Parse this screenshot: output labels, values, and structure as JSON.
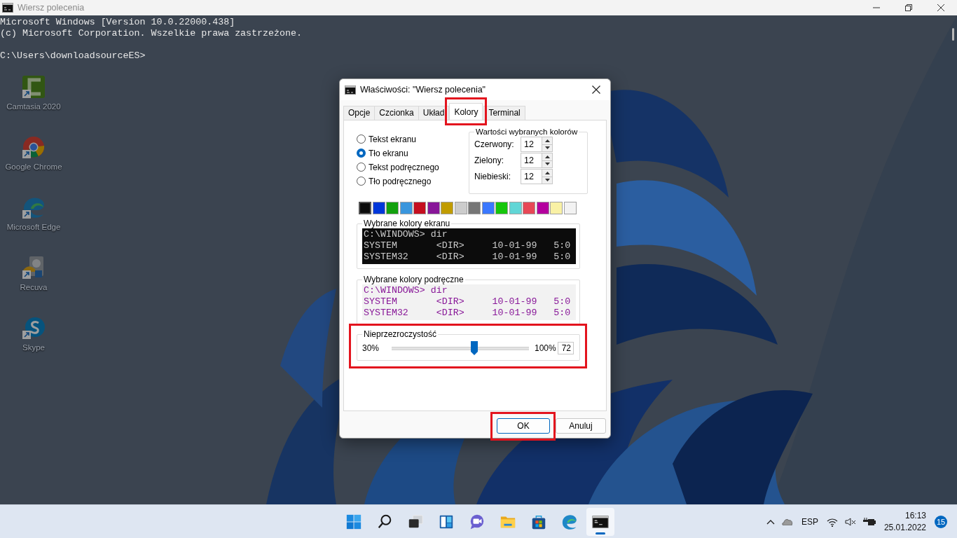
{
  "console": {
    "title": "Wiersz polecenia",
    "lines": [
      "Microsoft Windows [Version 10.0.22000.438]",
      "(c) Microsoft Corporation. Wszelkie prawa zastrzeżone."
    ],
    "prompt": "C:\\Users\\downloadsourceES>"
  },
  "desktop_icons": [
    {
      "kind": "camtasia",
      "label": "Camtasia 2020"
    },
    {
      "kind": "chrome",
      "label": "Google Chrome"
    },
    {
      "kind": "edge",
      "label": "Microsoft Edge"
    },
    {
      "kind": "recuva",
      "label": "Recuva"
    },
    {
      "kind": "skype",
      "label": "Skype"
    }
  ],
  "dialog": {
    "title": "Właściwości: \"Wiersz polecenia\"",
    "tabs": [
      {
        "label": "Opcje",
        "selected": false,
        "highlighted": false
      },
      {
        "label": "Czcionka",
        "selected": false,
        "highlighted": false
      },
      {
        "label": "Układ",
        "selected": false,
        "highlighted": false
      },
      {
        "label": "Kolory",
        "selected": true,
        "highlighted": true
      },
      {
        "label": "Terminal",
        "selected": false,
        "highlighted": false
      }
    ],
    "color_targets": [
      {
        "label": "Tekst ekranu",
        "selected": false
      },
      {
        "label": "Tło ekranu",
        "selected": true
      },
      {
        "label": "Tekst podręcznego",
        "selected": false
      },
      {
        "label": "Tło podręcznego",
        "selected": false
      }
    ],
    "color_values": {
      "title": "Wartości wybranych kolorów",
      "fields": [
        {
          "label": "Czerwony:",
          "value": "12"
        },
        {
          "label": "Zielony:",
          "value": "12"
        },
        {
          "label": "Niebieski:",
          "value": "12"
        }
      ]
    },
    "palette": [
      {
        "color": "#0c0c0c",
        "selected": true
      },
      {
        "color": "#0037da",
        "selected": false
      },
      {
        "color": "#13a10e",
        "selected": false
      },
      {
        "color": "#3a96dd",
        "selected": false
      },
      {
        "color": "#c50f1f",
        "selected": false
      },
      {
        "color": "#881798",
        "selected": false
      },
      {
        "color": "#c19c00",
        "selected": false
      },
      {
        "color": "#cccccc",
        "selected": false
      },
      {
        "color": "#767676",
        "selected": false
      },
      {
        "color": "#3b78ff",
        "selected": false
      },
      {
        "color": "#16c60c",
        "selected": false
      },
      {
        "color": "#61d6d6",
        "selected": false
      },
      {
        "color": "#e74856",
        "selected": false
      },
      {
        "color": "#b4009e",
        "selected": false
      },
      {
        "color": "#f9f1a5",
        "selected": false
      },
      {
        "color": "#f2f2f2",
        "selected": false
      }
    ],
    "previews": [
      {
        "kind": "screen",
        "title": "Wybrane kolory ekranu",
        "lines": [
          "C:\\WINDOWS> dir",
          "SYSTEM       <DIR>     10-01-99   5:0",
          "SYSTEM32     <DIR>     10-01-99   5:0"
        ]
      },
      {
        "kind": "popup",
        "title": "Wybrane kolory podręczne",
        "lines": [
          "C:\\WINDOWS> dir",
          "SYSTEM       <DIR>     10-01-99   5:0",
          "SYSTEM32     <DIR>     10-01-99   5:0"
        ]
      }
    ],
    "opacity": {
      "title": "Nieprzezroczystość",
      "min_label": "30%",
      "max_label": "100%",
      "level": 0.6,
      "value": "72",
      "highlighted": true
    },
    "buttons": [
      {
        "label": "OK",
        "default": true,
        "highlighted": true
      },
      {
        "label": "Anuluj",
        "default": false,
        "highlighted": false
      }
    ]
  },
  "taskbar": {
    "apps": [
      {
        "kind": "start",
        "active": false
      },
      {
        "kind": "search",
        "active": false
      },
      {
        "kind": "taskview",
        "active": false
      },
      {
        "kind": "widgets",
        "active": false
      },
      {
        "kind": "chat",
        "active": false
      },
      {
        "kind": "explorer",
        "active": false
      },
      {
        "kind": "store",
        "active": false
      },
      {
        "kind": "edge",
        "active": false
      },
      {
        "kind": "terminal",
        "active": true
      }
    ],
    "language": "ESP",
    "time": "16:13",
    "date": "25.01.2022",
    "notifications": "15"
  }
}
